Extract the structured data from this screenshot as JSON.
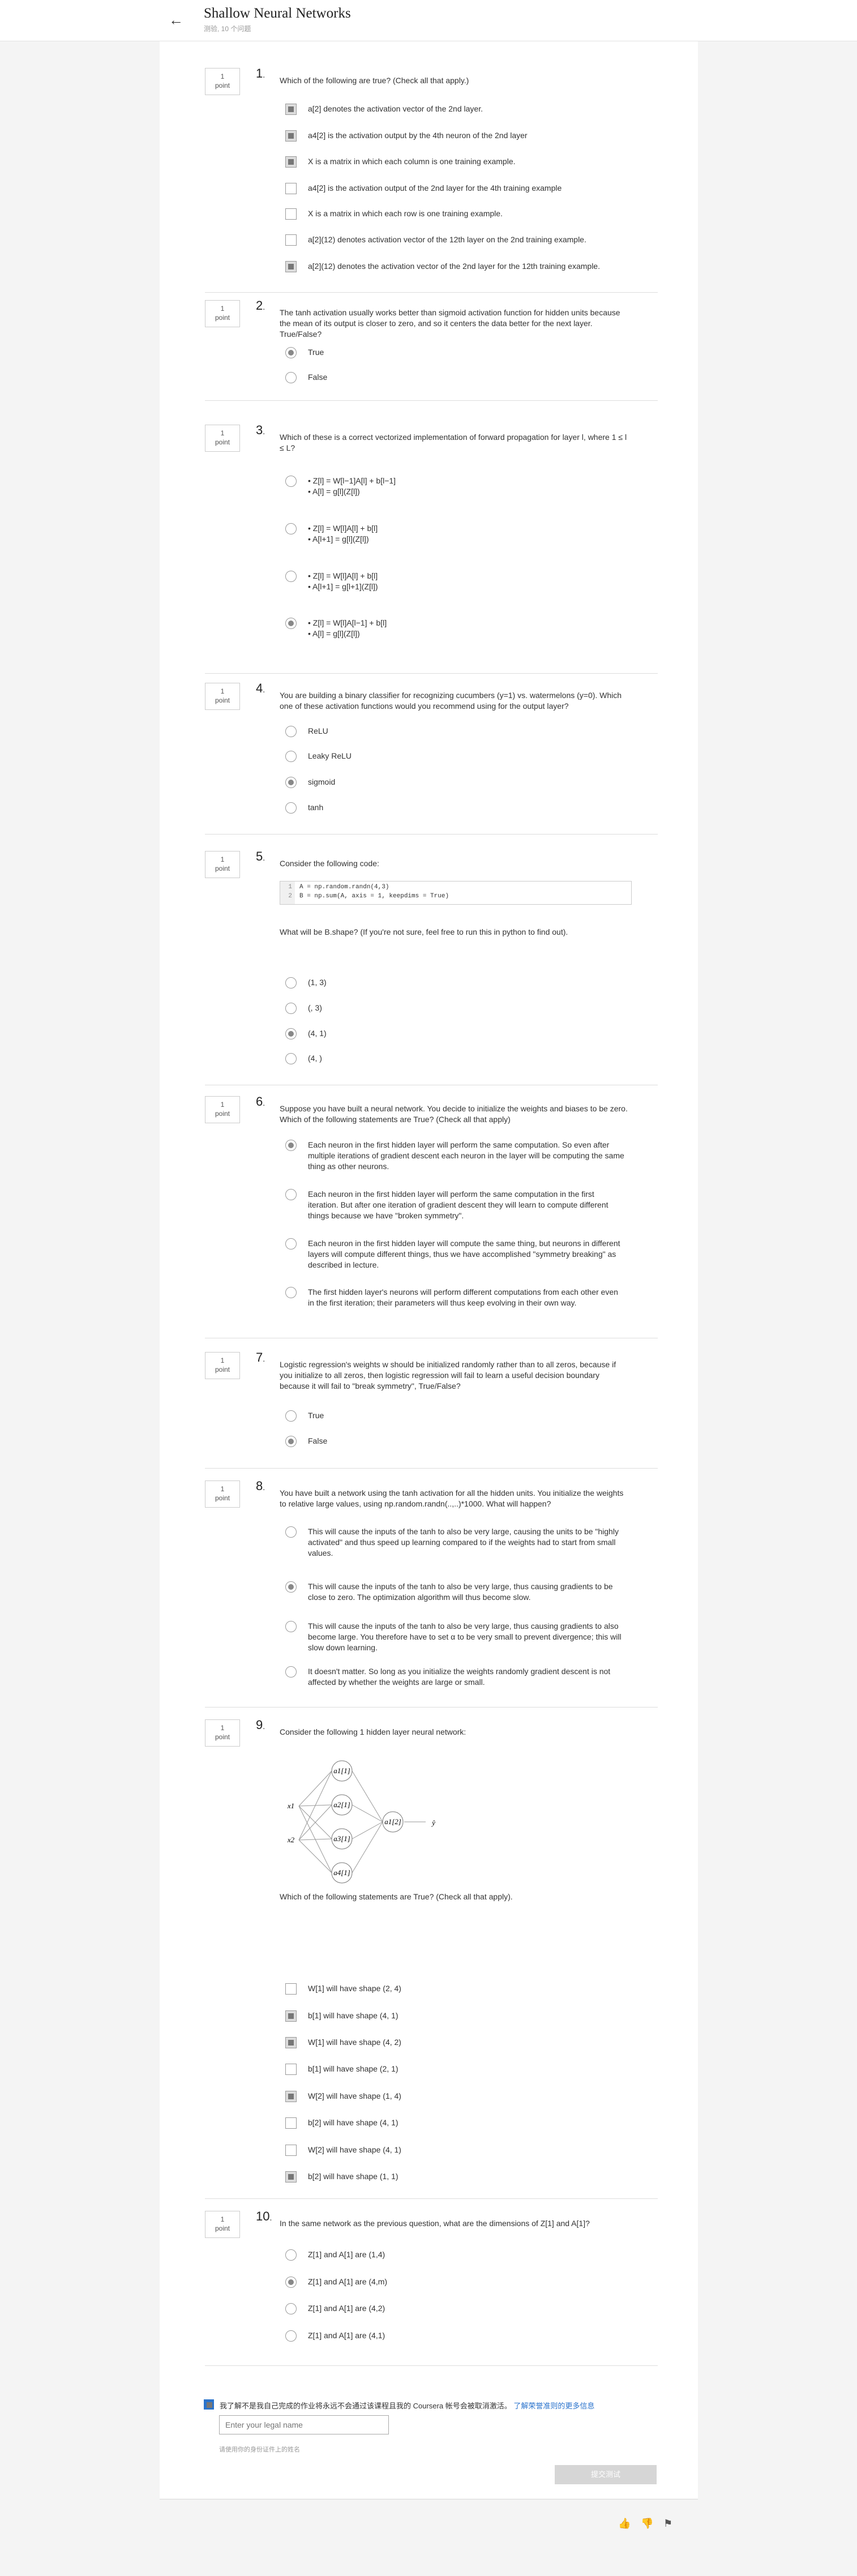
{
  "header": {
    "title": "Shallow Neural Networks",
    "subtitle": "测验, 10 个问题"
  },
  "questions": [
    {
      "num": "1",
      "points": "1\npoint",
      "text": "Which of the following are true? (Check all that apply.)",
      "type": "check",
      "options": [
        {
          "label": "a[2] denotes the activation vector of the 2nd layer.",
          "selected": true
        },
        {
          "label": "a4[2] is the activation output by the 4th neuron of the 2nd layer",
          "selected": true
        },
        {
          "label": "X is a matrix in which each column is one training example.",
          "selected": true
        },
        {
          "label": "a4[2] is the activation output of the 2nd layer for the 4th training example",
          "selected": false
        },
        {
          "label": "X is a matrix in which each row is one training example.",
          "selected": false
        },
        {
          "label": "a[2](12) denotes activation vector of the 12th layer on the 2nd training example.",
          "selected": false
        },
        {
          "label": "a[2](12) denotes the activation vector of the 2nd layer for the 12th training example.",
          "selected": true
        }
      ]
    },
    {
      "num": "2",
      "points": "1\npoint",
      "text": "The tanh activation usually works better than sigmoid activation function for hidden units because the mean of its output is closer to zero, and so it centers the data better for the next layer. True/False?",
      "type": "radio",
      "options": [
        {
          "label": "True",
          "selected": true
        },
        {
          "label": "False",
          "selected": false
        }
      ]
    },
    {
      "num": "3",
      "points": "1\npoint",
      "text": "Which of these is a correct vectorized implementation of forward propagation for layer l, where 1 ≤ l ≤ L?",
      "type": "radio",
      "options": [
        {
          "label": "• Z[l] = W[l−1]A[l] + b[l−1]\n• A[l] = g[l](Z[l])",
          "selected": false
        },
        {
          "label": "• Z[l] = W[l]A[l] + b[l]\n• A[l+1] = g[l](Z[l])",
          "selected": false
        },
        {
          "label": "• Z[l] = W[l]A[l] + b[l]\n• A[l+1] = g[l+1](Z[l])",
          "selected": false
        },
        {
          "label": "• Z[l] = W[l]A[l−1] + b[l]\n• A[l] = g[l](Z[l])",
          "selected": true
        }
      ]
    },
    {
      "num": "4",
      "points": "1\npoint",
      "text": "You are building a binary classifier for recognizing cucumbers (y=1) vs. watermelons (y=0). Which one of these activation functions would you recommend using for the output layer?",
      "type": "radio",
      "options": [
        {
          "label": "ReLU",
          "selected": false
        },
        {
          "label": "Leaky ReLU",
          "selected": false
        },
        {
          "label": "sigmoid",
          "selected": true
        },
        {
          "label": "tanh",
          "selected": false
        }
      ]
    },
    {
      "num": "5",
      "points": "1\npoint",
      "text": "Consider the following code:",
      "type": "radio",
      "after": "What will be B.shape? (If you're not sure, feel free to run this in python to find out).",
      "code": [
        "A = np.random.randn(4,3)",
        "B = np.sum(A, axis = 1, keepdims = True)"
      ],
      "options": [
        {
          "label": "(1, 3)",
          "selected": false
        },
        {
          "label": "(, 3)",
          "selected": false
        },
        {
          "label": "(4, 1)",
          "selected": true
        },
        {
          "label": "(4, )",
          "selected": false
        }
      ]
    },
    {
      "num": "6",
      "points": "1\npoint",
      "text": "Suppose you have built a neural network. You decide to initialize the weights and biases to be zero. Which of the following statements are True? (Check all that apply)",
      "type": "radio",
      "options": [
        {
          "label": "Each neuron in the first hidden layer will perform the same computation. So even after multiple iterations of gradient descent each neuron in the layer will be computing the same thing as other neurons.",
          "selected": true
        },
        {
          "label": "Each neuron in the first hidden layer will perform the same computation in the first iteration. But after one iteration of gradient descent they will learn to compute different things because we have \"broken symmetry\".",
          "selected": false
        },
        {
          "label": "Each neuron in the first hidden layer will compute the same thing, but neurons in different layers will compute different things, thus we have accomplished \"symmetry breaking\" as described in lecture.",
          "selected": false
        },
        {
          "label": "The first hidden layer's neurons will perform different computations from each other even in the first iteration; their parameters will thus keep evolving in their own way.",
          "selected": false
        }
      ]
    },
    {
      "num": "7",
      "points": "1\npoint",
      "text": "Logistic regression's weights w should be initialized randomly rather than to all zeros, because if you initialize to all zeros, then logistic regression will fail to learn a useful decision boundary because it will fail to \"break symmetry\", True/False?",
      "type": "radio",
      "options": [
        {
          "label": "True",
          "selected": false
        },
        {
          "label": "False",
          "selected": true
        }
      ]
    },
    {
      "num": "8",
      "points": "1\npoint",
      "text": "You have built a network using the tanh activation for all the hidden units. You initialize the weights to relative large values, using np.random.randn(..,..)*1000. What will happen?",
      "type": "radio",
      "options": [
        {
          "label": "This will cause the inputs of the tanh to also be very large, causing the units to be \"highly activated\" and thus speed up learning compared to if the weights had to start from small values.",
          "selected": false
        },
        {
          "label": "This will cause the inputs of the tanh to also be very large, thus causing gradients to be close to zero. The optimization algorithm will thus become slow.",
          "selected": true
        },
        {
          "label": "This will cause the inputs of the tanh to also be very large, thus causing gradients to also become large. You therefore have to set α to be very small to prevent divergence; this will slow down learning.",
          "selected": false
        },
        {
          "label": "It doesn't matter. So long as you initialize the weights randomly gradient descent is not affected by whether the weights are large or small.",
          "selected": false
        }
      ]
    },
    {
      "num": "9",
      "points": "1\npoint",
      "text": "Consider the following 1 hidden layer neural network:",
      "type": "check",
      "after": "Which of the following statements are True? (Check all that apply).",
      "diagram": {
        "inputs": [
          "x1",
          "x2"
        ],
        "hidden": [
          "a1[1]",
          "a2[1]",
          "a3[1]",
          "a4[1]"
        ],
        "output": "a1[2]",
        "yhat": "ŷ"
      },
      "options": [
        {
          "label": "W[1] will have shape (2, 4)",
          "selected": false
        },
        {
          "label": "b[1] will have shape (4, 1)",
          "selected": true
        },
        {
          "label": "W[1] will have shape (4, 2)",
          "selected": true
        },
        {
          "label": "b[1] will have shape (2, 1)",
          "selected": false
        },
        {
          "label": "W[2] will have shape (1, 4)",
          "selected": true
        },
        {
          "label": "b[2] will have shape (4, 1)",
          "selected": false
        },
        {
          "label": "W[2] will have shape (4, 1)",
          "selected": false
        },
        {
          "label": "b[2] will have shape (1, 1)",
          "selected": true
        }
      ]
    },
    {
      "num": "10",
      "points": "1\npoint",
      "text": "In the same network as the previous question, what are the dimensions of Z[1] and A[1]?",
      "type": "radio",
      "options": [
        {
          "label": "Z[1] and A[1] are (1,4)",
          "selected": false
        },
        {
          "label": "Z[1] and A[1] are (4,m)",
          "selected": true
        },
        {
          "label": "Z[1] and A[1] are (4,2)",
          "selected": false
        },
        {
          "label": "Z[1] and A[1] are (4,1)",
          "selected": false
        }
      ]
    }
  ],
  "footer": {
    "honor_text": "我了解不是我自己完成的作业将永远不会通过该课程且我的 Coursera 帐号会被取消激活。",
    "honor_link": "了解荣誉准则的更多信息",
    "legal_placeholder": "Enter your legal name",
    "legal_hint": "请使用你的身份证件上的姓名",
    "submit": "提交测试"
  }
}
